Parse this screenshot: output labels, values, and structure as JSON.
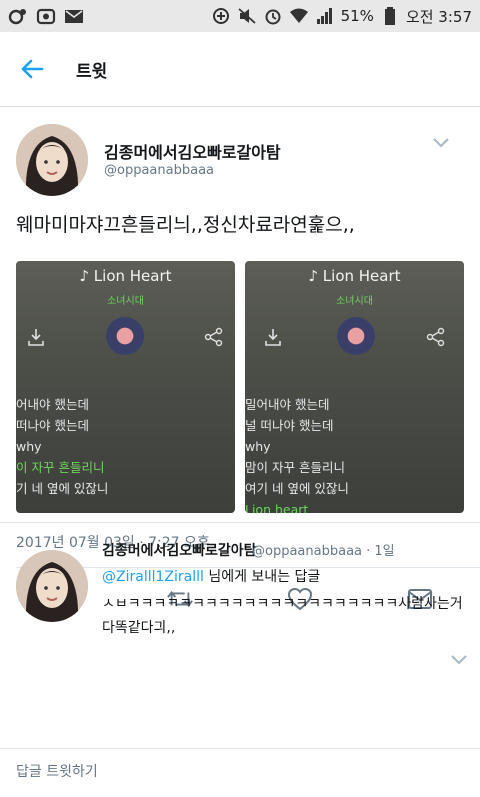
{
  "status_bar": {
    "battery": "51%",
    "time": "오전 3:57"
  },
  "app_bar": {
    "title": "트윗"
  },
  "tweet": {
    "display_name": "김종머에서김오빠로갈아탐",
    "handle": "@oppaanabbaaa",
    "text": "웨마미마쟈끄흔들리늬,,정신차료라연훑으,,",
    "media": [
      {
        "song": "Lion Heart",
        "artist": "소녀시대",
        "lyrics": [
          {
            "text": "",
            "style": "fade"
          },
          {
            "text": "어내야 했는데",
            "style": "normal"
          },
          {
            "text": "떠나야 했는데",
            "style": "normal"
          },
          {
            "text": "why",
            "style": "normal"
          },
          {
            "text": "이 자꾸 흔들리니",
            "style": "hl"
          },
          {
            "text": "기 네 옆에 있잖니",
            "style": "normal"
          }
        ]
      },
      {
        "song": "Lion Heart",
        "artist": "소녀시대",
        "lyrics": [
          {
            "text": "",
            "style": "fade"
          },
          {
            "text": "밀어내야 했는데",
            "style": "normal"
          },
          {
            "text": "널 떠나야 했는데",
            "style": "normal"
          },
          {
            "text": "why",
            "style": "normal"
          },
          {
            "text": "맘이 자꾸 흔들리니",
            "style": "normal"
          },
          {
            "text": "여기 네 옆에 있잖니",
            "style": "normal"
          },
          {
            "text": "Lion heart",
            "style": "hl"
          }
        ]
      }
    ],
    "timestamp": "2017년 07월 03일 · 7:27 오후"
  },
  "reply": {
    "display_name": "김종머에서김오빠로갈아탐",
    "handle": "@oppaanabbaaa · 1일",
    "mention": "@Ziralll1Ziralll",
    "reply_suffix": " 님에게 보내는 답글",
    "text": "ㅅㅂㅋㅋㅋㅋㅋㅋㅋㅋㅋㅋㅋㅋㅋㅋㅋㅋㅋㅋㅋㅋㅋ사람사는거다똑같다긔,,"
  },
  "compose": {
    "placeholder": "답글 트윗하기"
  },
  "colors": {
    "accent": "#1da1f2",
    "lyric_highlight": "#6fd35f",
    "secondary_text": "#657786"
  }
}
